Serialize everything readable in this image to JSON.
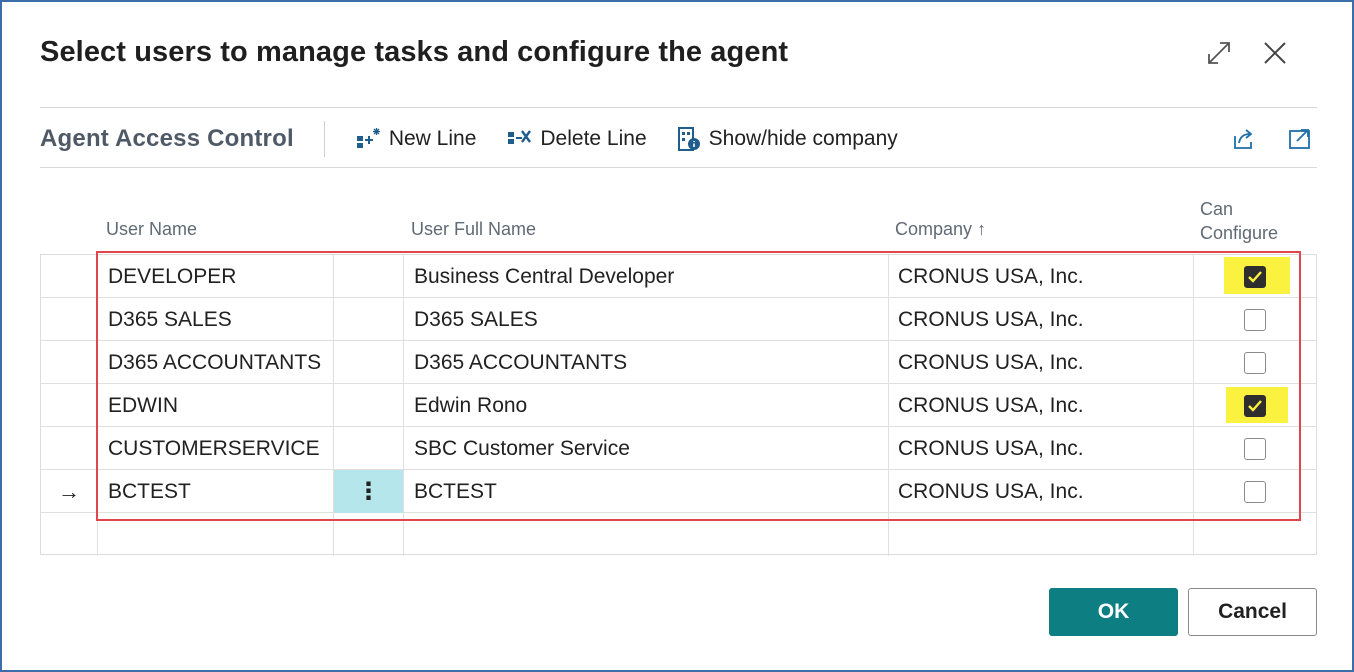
{
  "dialog": {
    "title": "Select users to manage tasks and configure the agent"
  },
  "toolbar": {
    "page_caption": "Agent Access Control",
    "actions": [
      {
        "label": "New Line",
        "icon": "new-line-icon"
      },
      {
        "label": "Delete Line",
        "icon": "delete-line-icon"
      },
      {
        "label": "Show/hide company",
        "icon": "show-hide-company-icon"
      }
    ],
    "right_icons": [
      "share-icon",
      "open-in-new-icon"
    ]
  },
  "columns": {
    "user_name": "User Name",
    "user_full_name": "User Full Name",
    "company": "Company",
    "company_sort": "↑",
    "can_configure_line1": "Can",
    "can_configure_line2": "Configure"
  },
  "rows": [
    {
      "user_name": "DEVELOPER",
      "full_name": "Business Central Developer",
      "company": "CRONUS USA, Inc.",
      "can_configure": true,
      "indicator": ""
    },
    {
      "user_name": "D365 SALES",
      "full_name": "D365 SALES",
      "company": "CRONUS USA, Inc.",
      "can_configure": false,
      "indicator": ""
    },
    {
      "user_name": "D365 ACCOUNTANTS",
      "full_name": "D365 ACCOUNTANTS",
      "company": "CRONUS USA, Inc.",
      "can_configure": false,
      "indicator": ""
    },
    {
      "user_name": "EDWIN",
      "full_name": "Edwin Rono",
      "company": "CRONUS USA, Inc.",
      "can_configure": true,
      "indicator": ""
    },
    {
      "user_name": "CUSTOMERSERVICE",
      "full_name": "SBC Customer Service",
      "company": "CRONUS USA, Inc.",
      "can_configure": false,
      "indicator": ""
    },
    {
      "user_name": "BCTEST",
      "full_name": "BCTEST",
      "company": "CRONUS USA, Inc.",
      "can_configure": false,
      "indicator": "→",
      "menu": "⋮"
    }
  ],
  "buttons": {
    "ok": "OK",
    "cancel": "Cancel"
  },
  "colors": {
    "accent": "#0d7f83",
    "highlight": "#fbf23f",
    "annotation_red": "#e0474c",
    "active_cell": "#b5e6ec"
  }
}
